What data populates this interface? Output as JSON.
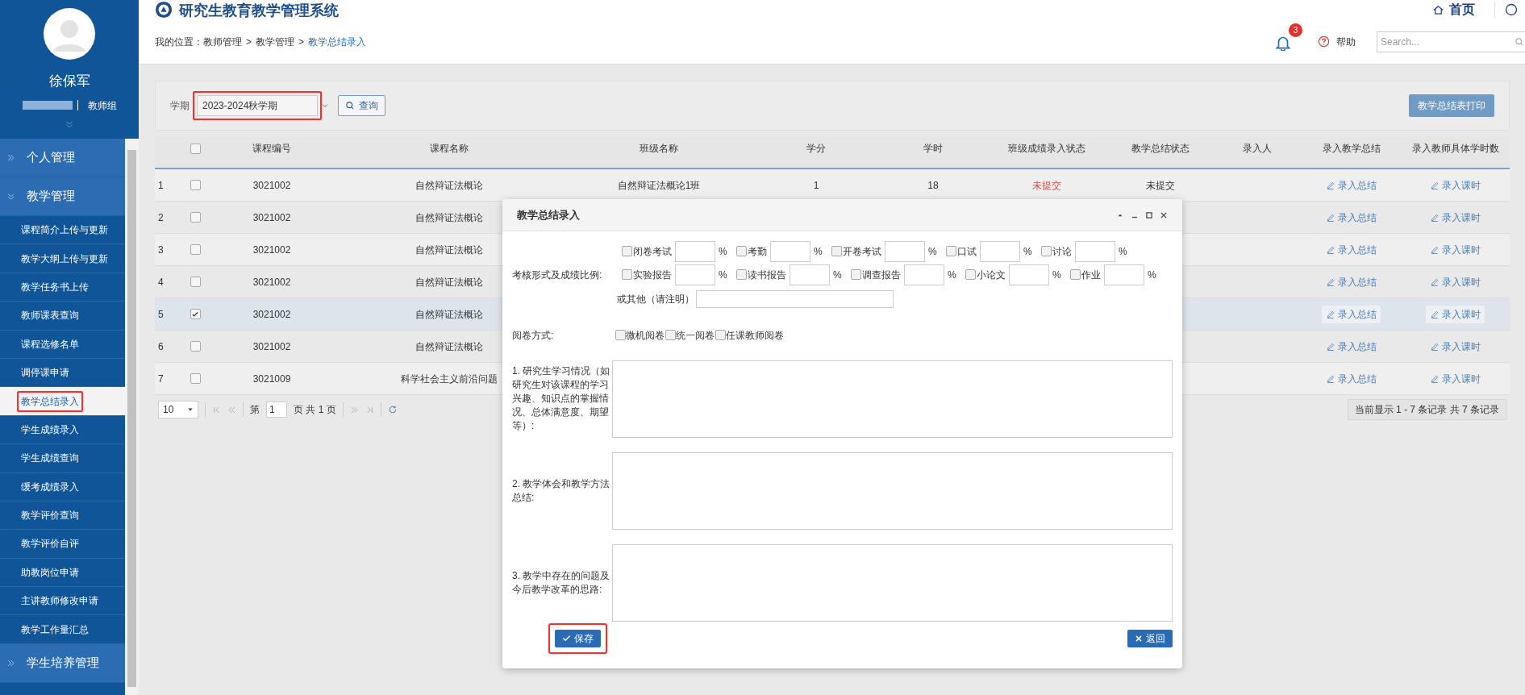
{
  "header": {
    "title": "研究生教育教学管理系统",
    "home": "首页"
  },
  "sidebar": {
    "user_name": "徐保军",
    "group": "教师组",
    "menu": [
      {
        "label": "个人管理",
        "expanded": false
      },
      {
        "label": "教学管理",
        "expanded": true,
        "children": [
          {
            "label": "课程简介上传与更新",
            "selected": false,
            "highlighted": false
          },
          {
            "label": "教学大纲上传与更新",
            "selected": false,
            "highlighted": false
          },
          {
            "label": "教学任务书上传",
            "selected": false,
            "highlighted": false
          },
          {
            "label": "教师课表查询",
            "selected": false,
            "highlighted": false
          },
          {
            "label": "课程选修名单",
            "selected": false,
            "highlighted": false
          },
          {
            "label": "调停课申请",
            "selected": false,
            "highlighted": false
          },
          {
            "label": "教学总结录入",
            "selected": true,
            "highlighted": true
          },
          {
            "label": "学生成绩录入",
            "selected": false,
            "highlighted": false
          },
          {
            "label": "学生成绩查询",
            "selected": false,
            "highlighted": false
          },
          {
            "label": "缓考成绩录入",
            "selected": false,
            "highlighted": false
          },
          {
            "label": "教学评价查询",
            "selected": false,
            "highlighted": false
          },
          {
            "label": "教学评价自评",
            "selected": false,
            "highlighted": false
          },
          {
            "label": "助教岗位申请",
            "selected": false,
            "highlighted": false
          },
          {
            "label": "主讲教师修改申请",
            "selected": false,
            "highlighted": false
          },
          {
            "label": "教学工作量汇总",
            "selected": false,
            "highlighted": false
          }
        ]
      },
      {
        "label": "学生培养管理",
        "expanded": false
      }
    ]
  },
  "breadcrumb": {
    "prefix": "我的位置：",
    "separator": ">",
    "items": [
      "教师管理",
      "教学管理",
      "教学总结录入"
    ]
  },
  "toolbar": {
    "notification_count": "3",
    "help": "帮助",
    "search_placeholder": "Search..."
  },
  "filter": {
    "label": "学期",
    "term": "2023-2024秋学期",
    "term_highlighted": true,
    "query": "查询",
    "print": "教学总结表打印"
  },
  "table": {
    "header_checked": false,
    "columns": [
      "课程编号",
      "课程名称",
      "班级名称",
      "学分",
      "学时",
      "班级成绩录入状态",
      "教学总结状态",
      "录入人",
      "录入教学总结",
      "录入教师具体学时数"
    ],
    "rows": [
      {
        "index": "1",
        "checked": false,
        "selected": false,
        "code": "3021002",
        "name": "自然辩证法概论",
        "class_name": "自然辩证法概论1班",
        "credits": "1",
        "hours": "18",
        "grade_status": "未提交",
        "summary_status": "未提交",
        "summary_action": "录入总结",
        "hours_action": "录入课时"
      },
      {
        "index": "2",
        "checked": false,
        "selected": false,
        "code": "3021002",
        "name": "自然辩证法概论",
        "summary_action": "录入总结",
        "hours_action": "录入课时"
      },
      {
        "index": "3",
        "checked": false,
        "selected": false,
        "code": "3021002",
        "name": "自然辩证法概论",
        "summary_action": "录入总结",
        "hours_action": "录入课时"
      },
      {
        "index": "4",
        "checked": false,
        "selected": false,
        "code": "3021002",
        "name": "自然辩证法概论",
        "summary_action": "录入总结",
        "hours_action": "录入课时"
      },
      {
        "index": "5",
        "checked": true,
        "selected": true,
        "code": "3021002",
        "name": "自然辩证法概论",
        "summary_action": "录入总结",
        "hours_action": "录入课时"
      },
      {
        "index": "6",
        "checked": false,
        "selected": false,
        "code": "3021002",
        "name": "自然辩证法概论",
        "summary_action": "录入总结",
        "hours_action": "录入课时"
      },
      {
        "index": "7",
        "checked": false,
        "selected": false,
        "code": "3021009",
        "name": "科学社会主义前沿问题",
        "summary_action": "录入总结",
        "hours_action": "录入课时"
      }
    ]
  },
  "pagination": {
    "page_size": "10",
    "page_prefix": "第",
    "page": "1",
    "page_suffix": "页 共 1 页",
    "summary": "当前显示 1 - 7 条记录 共 7 条记录"
  },
  "dialog": {
    "title": "教学总结录入",
    "assessment_label": "考核形式及成绩比例:",
    "assessment_items": [
      {
        "label": "闭卷考试",
        "checked": false,
        "unit": "%"
      },
      {
        "label": "考勤",
        "checked": false,
        "unit": "%"
      },
      {
        "label": "开卷考试",
        "checked": false,
        "unit": "%"
      },
      {
        "label": "口试",
        "checked": false,
        "unit": "%"
      },
      {
        "label": "讨论",
        "checked": false,
        "unit": "%"
      },
      {
        "label": "实验报告",
        "checked": false,
        "unit": "%"
      },
      {
        "label": "读书报告",
        "checked": false,
        "unit": "%"
      },
      {
        "label": "调查报告",
        "checked": false,
        "unit": "%"
      },
      {
        "label": "小论文",
        "checked": false,
        "unit": "%"
      },
      {
        "label": "作业",
        "checked": false,
        "unit": "%"
      }
    ],
    "other_label": "或其他（请注明）",
    "marking_label": "阅卷方式:",
    "marking_options": [
      {
        "label": "微机阅卷",
        "checked": false
      },
      {
        "label": "统一阅卷",
        "checked": false
      },
      {
        "label": "任课教师阅卷",
        "checked": false
      }
    ],
    "questions": [
      {
        "label": "1. 研究生学习情况（如研究生对该课程的学习兴趣、知识点的掌握情况、总体满意度、期望等）:"
      },
      {
        "label": "2. 教学体会和教学方法总结:"
      },
      {
        "label": "3. 教学中存在的问题及今后教学改革的思路:"
      }
    ],
    "save": "保存",
    "save_highlighted": true,
    "back": "返回"
  }
}
